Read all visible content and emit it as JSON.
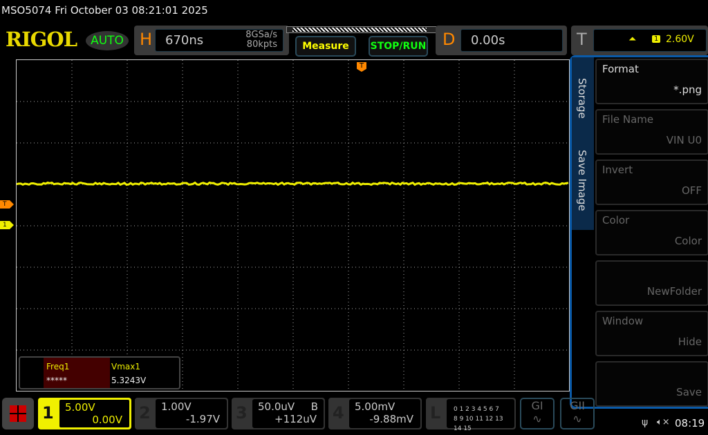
{
  "title": "MSO5074  Fri October 03 08:21:01 2025",
  "logo": "RIGOL",
  "mode": "AUTO",
  "horizontal": {
    "label": "H",
    "timebase": "670ns",
    "sample_rate": "8GSa/s",
    "memory": "80kpts"
  },
  "buttons": {
    "measure": "Measure",
    "stop_run": "STOP/RUN"
  },
  "delay": {
    "label": "D",
    "value": "0.00s"
  },
  "trigger": {
    "label": "T",
    "source": "1",
    "level": "2.60V",
    "mode": "A",
    "marker": "T"
  },
  "side_menu": {
    "tabs": [
      "Storage",
      "Save Image"
    ],
    "items": [
      {
        "label": "Format",
        "value": "*.png"
      },
      {
        "label": "File Name",
        "value": "VIN U0"
      },
      {
        "label": "Invert",
        "value": "OFF"
      },
      {
        "label": "Color",
        "value": "Color"
      },
      {
        "label": "",
        "value": "NewFolder"
      },
      {
        "label": "Window",
        "value": "Hide"
      },
      {
        "label": "",
        "value": "Save"
      }
    ]
  },
  "measurements": [
    {
      "label": "Freq1",
      "value": "*****"
    },
    {
      "label": "Vmax1",
      "value": "5.3243V"
    }
  ],
  "channels": [
    {
      "num": "1",
      "scale": "5.00V",
      "offset": "0.00V",
      "color": "#f0f000"
    },
    {
      "num": "2",
      "scale": "1.00V",
      "offset": "-1.97V"
    },
    {
      "num": "3",
      "scale": "50.0uV",
      "extra": "B",
      "offset": "+112uV"
    },
    {
      "num": "4",
      "scale": "5.00mV",
      "offset": "-9.88mV"
    }
  ],
  "logic": {
    "label": "L",
    "row1": "0 1 2 3  4 5 6 7",
    "row2": "8 9 10 11 12 13 14 15"
  },
  "generators": [
    "GI",
    "GII"
  ],
  "status": {
    "time": "08:19"
  },
  "markers": {
    "trigger": "T",
    "ch1": "1"
  }
}
